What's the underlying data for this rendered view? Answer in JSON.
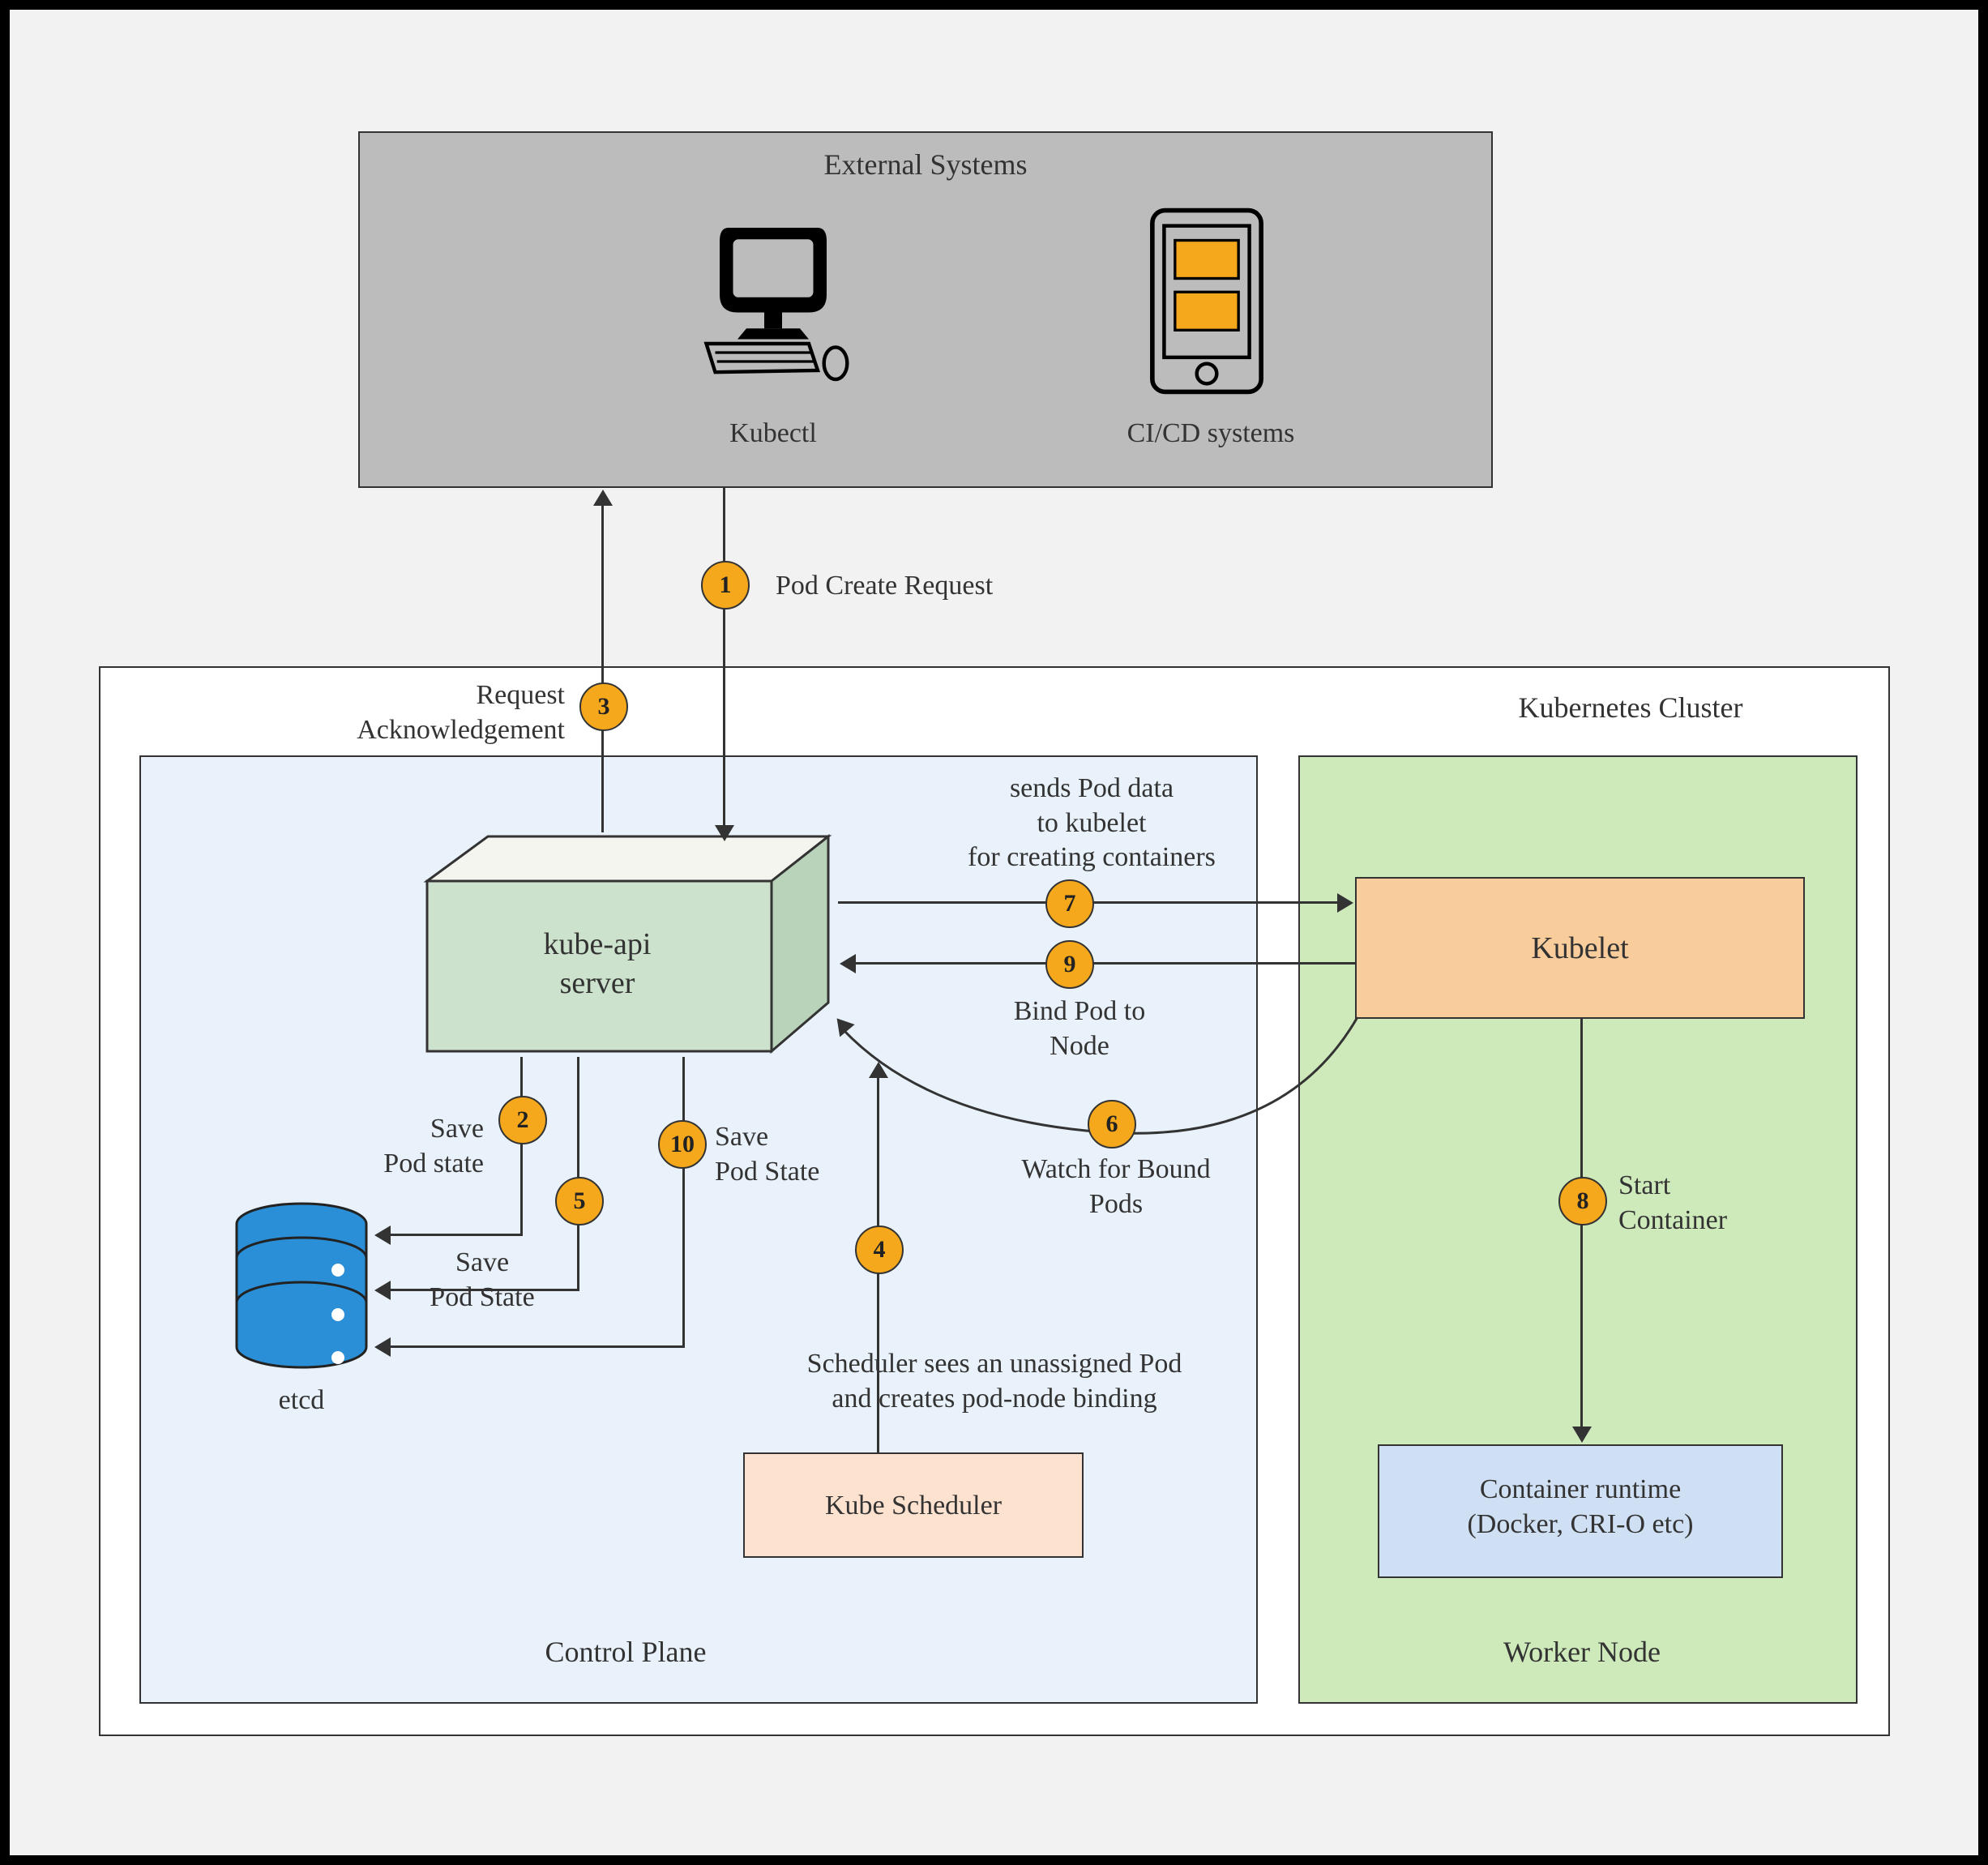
{
  "ext": {
    "title": "External Systems",
    "kubectl": "Kubectl",
    "cicd": "CI/CD systems"
  },
  "cluster": {
    "title": "Kubernetes Cluster"
  },
  "control": {
    "title": "Control Plane",
    "api": "kube-api\nserver",
    "etcd": "etcd",
    "sched": "Kube Scheduler"
  },
  "worker": {
    "title": "Worker Node",
    "kubelet": "Kubelet",
    "runtime": "Container runtime\n(Docker, CRI-O etc)"
  },
  "steps": {
    "1": {
      "n": "1",
      "t": "Pod Create Request"
    },
    "2": {
      "n": "2",
      "t": "Save\nPod state"
    },
    "3": {
      "n": "3",
      "t": "Request\nAcknowledgement"
    },
    "4": {
      "n": "4",
      "t": "Scheduler sees an unassigned Pod\nand creates pod-node binding"
    },
    "5": {
      "n": "5",
      "t": "Save\nPod State"
    },
    "6": {
      "n": "6",
      "t": "Watch for Bound\nPods"
    },
    "7": {
      "n": "7",
      "t": "sends Pod data\nto kubelet\nfor creating containers"
    },
    "8": {
      "n": "8",
      "t": "Start\nContainer"
    },
    "9": {
      "n": "9",
      "t": "Bind Pod to\nNode"
    },
    "10": {
      "n": "10",
      "t": "Save\nPod State"
    }
  }
}
